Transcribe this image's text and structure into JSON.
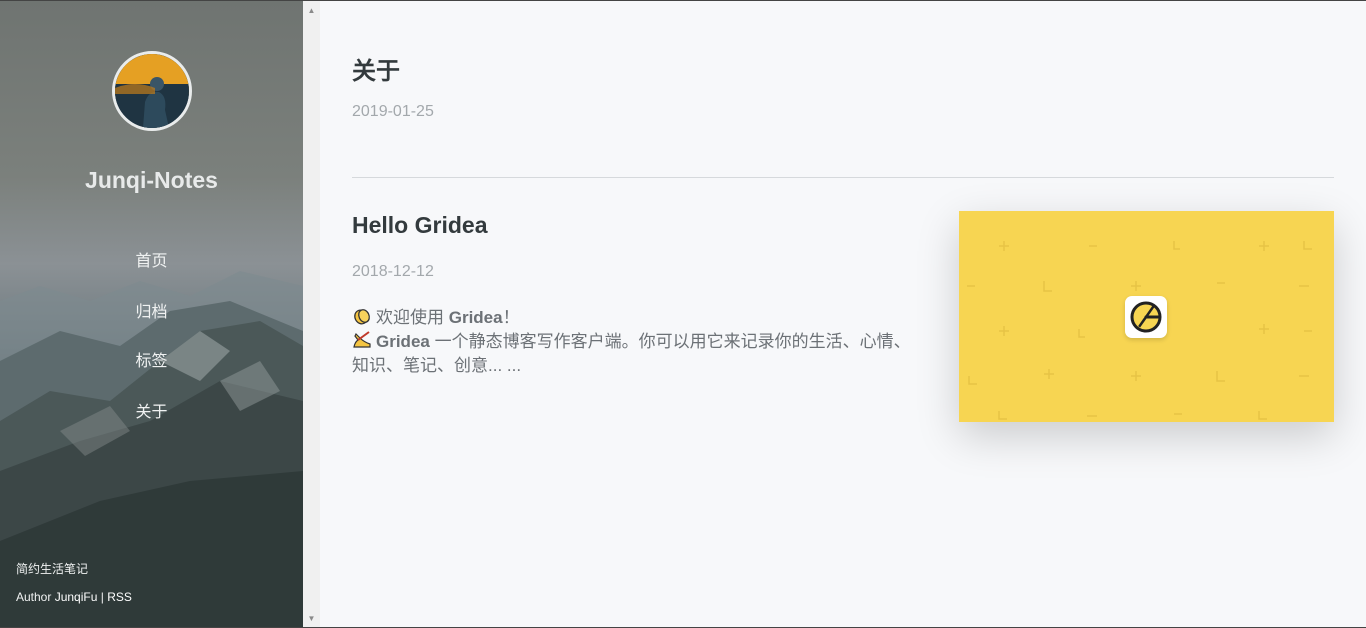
{
  "sidebar": {
    "site_title": "Junqi-Notes",
    "menu": [
      {
        "label": "首页"
      },
      {
        "label": "归档"
      },
      {
        "label": "标签"
      },
      {
        "label": "关于"
      }
    ],
    "footer": {
      "motto": "简约生活笔记",
      "author_prefix": "Author ",
      "author_name": "JunqiFu",
      "separator": " | ",
      "rss": "RSS"
    }
  },
  "posts": [
    {
      "title": "关于",
      "date": "2019-01-25"
    },
    {
      "title": "Hello Gridea",
      "date": "2018-12-12",
      "line1_prefix": "欢迎使用 ",
      "line1_brand": "Gridea",
      "line1_suffix": "！",
      "line2_brand": "Gridea",
      "line2_text": " 一个静态博客写作客户端。你可以用它来记录你的生活、心情、知识、笔记、创意... ...",
      "feature_image": "gridea-logo-icon"
    }
  ],
  "colors": {
    "accent_yellow": "#f7d552",
    "title_text": "#333a3d",
    "date_text": "#a3a8ac"
  }
}
